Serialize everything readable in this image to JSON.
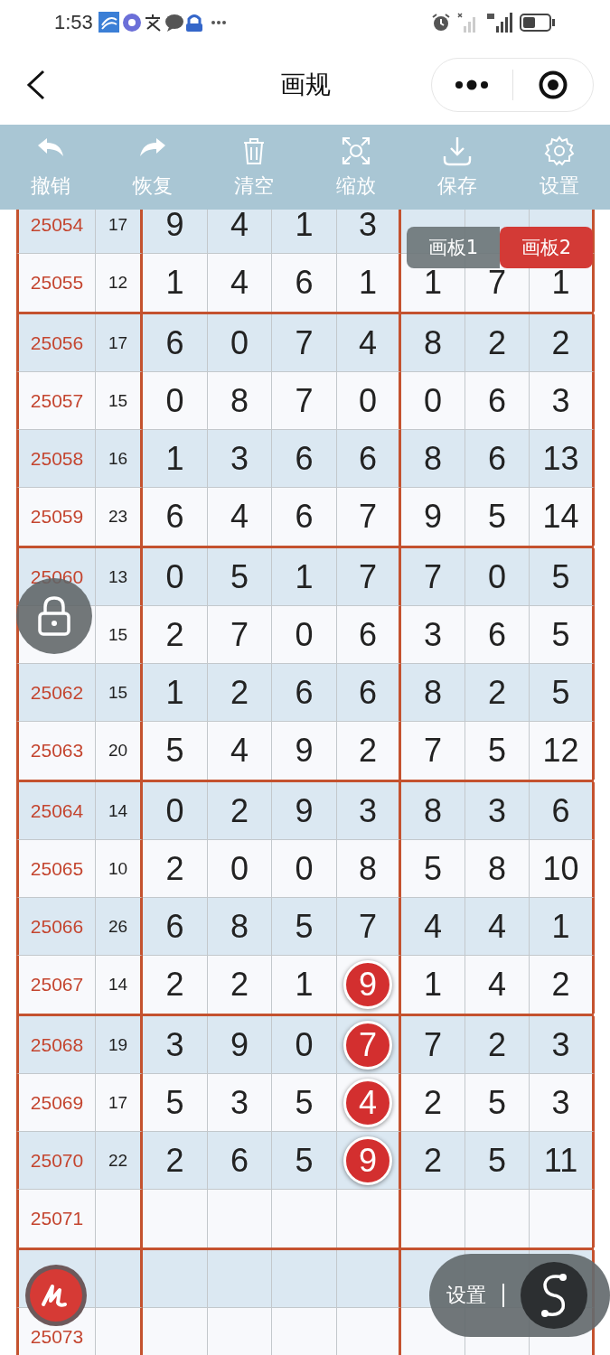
{
  "status_bar": {
    "time": "1:53"
  },
  "nav": {
    "title": "画规"
  },
  "toolbar": [
    {
      "label": "撤销"
    },
    {
      "label": "恢复"
    },
    {
      "label": "清空"
    },
    {
      "label": "缩放"
    },
    {
      "label": "保存"
    },
    {
      "label": "设置"
    }
  ],
  "board_tabs": [
    {
      "label": "画板1",
      "selected": false
    },
    {
      "label": "画板2",
      "selected": true
    }
  ],
  "groups": [
    {
      "rows": [
        {
          "issue": "25054",
          "sum": "17",
          "cells": [
            {
              "v": "9",
              "circled": false
            },
            {
              "v": "4",
              "circled": false
            },
            {
              "v": "1",
              "circled": false
            },
            {
              "v": "3",
              "circled": false
            }
          ]
        },
        {
          "issue": "25055",
          "sum": "12",
          "cells": [
            {
              "v": "1",
              "circled": false
            },
            {
              "v": "4",
              "circled": false
            },
            {
              "v": "6",
              "circled": false
            },
            {
              "v": "1",
              "circled": false
            },
            {
              "v": "1",
              "circled": false
            },
            {
              "v": "7",
              "circled": false
            },
            {
              "v": "1",
              "circled": false
            }
          ]
        }
      ]
    },
    {
      "rows": [
        {
          "issue": "25056",
          "sum": "17",
          "cells": [
            {
              "v": "6",
              "circled": false
            },
            {
              "v": "0",
              "circled": false
            },
            {
              "v": "7",
              "circled": false
            },
            {
              "v": "4",
              "circled": false
            },
            {
              "v": "8",
              "circled": false
            },
            {
              "v": "2",
              "circled": false
            },
            {
              "v": "2",
              "circled": false
            }
          ]
        },
        {
          "issue": "25057",
          "sum": "15",
          "cells": [
            {
              "v": "0",
              "circled": false
            },
            {
              "v": "8",
              "circled": false
            },
            {
              "v": "7",
              "circled": false
            },
            {
              "v": "0",
              "circled": false
            },
            {
              "v": "0",
              "circled": false
            },
            {
              "v": "6",
              "circled": false
            },
            {
              "v": "3",
              "circled": false
            }
          ]
        },
        {
          "issue": "25058",
          "sum": "16",
          "cells": [
            {
              "v": "1",
              "circled": false
            },
            {
              "v": "3",
              "circled": false
            },
            {
              "v": "6",
              "circled": false
            },
            {
              "v": "6",
              "circled": false
            },
            {
              "v": "8",
              "circled": false
            },
            {
              "v": "6",
              "circled": false
            },
            {
              "v": "13",
              "circled": false
            }
          ]
        },
        {
          "issue": "25059",
          "sum": "23",
          "cells": [
            {
              "v": "6",
              "circled": false
            },
            {
              "v": "4",
              "circled": false
            },
            {
              "v": "6",
              "circled": false
            },
            {
              "v": "7",
              "circled": false
            },
            {
              "v": "9",
              "circled": false
            },
            {
              "v": "5",
              "circled": false
            },
            {
              "v": "14",
              "circled": false
            }
          ]
        }
      ]
    },
    {
      "rows": [
        {
          "issue": "25060",
          "sum": "13",
          "cells": [
            {
              "v": "0",
              "circled": false
            },
            {
              "v": "5",
              "circled": false
            },
            {
              "v": "1",
              "circled": false
            },
            {
              "v": "7",
              "circled": false
            },
            {
              "v": "7",
              "circled": false
            },
            {
              "v": "0",
              "circled": false
            },
            {
              "v": "5",
              "circled": false
            }
          ]
        },
        {
          "sum": "15",
          "cells": [
            {
              "v": "2",
              "circled": false
            },
            {
              "v": "7",
              "circled": false
            },
            {
              "v": "0",
              "circled": false
            },
            {
              "v": "6",
              "circled": false
            },
            {
              "v": "3",
              "circled": false
            },
            {
              "v": "6",
              "circled": false
            },
            {
              "v": "5",
              "circled": false
            }
          ]
        },
        {
          "issue": "25062",
          "sum": "15",
          "cells": [
            {
              "v": "1",
              "circled": false
            },
            {
              "v": "2",
              "circled": false
            },
            {
              "v": "6",
              "circled": false
            },
            {
              "v": "6",
              "circled": false
            },
            {
              "v": "8",
              "circled": false
            },
            {
              "v": "2",
              "circled": false
            },
            {
              "v": "5",
              "circled": false
            }
          ]
        },
        {
          "issue": "25063",
          "sum": "20",
          "cells": [
            {
              "v": "5",
              "circled": false
            },
            {
              "v": "4",
              "circled": false
            },
            {
              "v": "9",
              "circled": false
            },
            {
              "v": "2",
              "circled": false
            },
            {
              "v": "7",
              "circled": false
            },
            {
              "v": "5",
              "circled": false
            },
            {
              "v": "12",
              "circled": false
            }
          ]
        }
      ]
    },
    {
      "rows": [
        {
          "issue": "25064",
          "sum": "14",
          "cells": [
            {
              "v": "0",
              "circled": false
            },
            {
              "v": "2",
              "circled": false
            },
            {
              "v": "9",
              "circled": false
            },
            {
              "v": "3",
              "circled": false
            },
            {
              "v": "8",
              "circled": false
            },
            {
              "v": "3",
              "circled": false
            },
            {
              "v": "6",
              "circled": false
            }
          ]
        },
        {
          "issue": "25065",
          "sum": "10",
          "cells": [
            {
              "v": "2",
              "circled": false
            },
            {
              "v": "0",
              "circled": false
            },
            {
              "v": "0",
              "circled": false
            },
            {
              "v": "8",
              "circled": false
            },
            {
              "v": "5",
              "circled": false
            },
            {
              "v": "8",
              "circled": false
            },
            {
              "v": "10",
              "circled": false
            }
          ]
        },
        {
          "issue": "25066",
          "sum": "26",
          "cells": [
            {
              "v": "6",
              "circled": false
            },
            {
              "v": "8",
              "circled": false
            },
            {
              "v": "5",
              "circled": false
            },
            {
              "v": "7",
              "circled": false
            },
            {
              "v": "4",
              "circled": false
            },
            {
              "v": "4",
              "circled": false
            },
            {
              "v": "1",
              "circled": false
            }
          ]
        },
        {
          "issue": "25067",
          "sum": "14",
          "cells": [
            {
              "v": "2",
              "circled": false
            },
            {
              "v": "2",
              "circled": false
            },
            {
              "v": "1",
              "circled": false
            },
            {
              "v": "9",
              "circled": true
            },
            {
              "v": "1",
              "circled": false
            },
            {
              "v": "4",
              "circled": false
            },
            {
              "v": "2",
              "circled": false
            }
          ]
        }
      ]
    },
    {
      "rows": [
        {
          "issue": "25068",
          "sum": "19",
          "cells": [
            {
              "v": "3",
              "circled": false
            },
            {
              "v": "9",
              "circled": false
            },
            {
              "v": "0",
              "circled": false
            },
            {
              "v": "7",
              "circled": true
            },
            {
              "v": "7",
              "circled": false
            },
            {
              "v": "2",
              "circled": false
            },
            {
              "v": "3",
              "circled": false
            }
          ]
        },
        {
          "issue": "25069",
          "sum": "17",
          "cells": [
            {
              "v": "5",
              "circled": false
            },
            {
              "v": "3",
              "circled": false
            },
            {
              "v": "5",
              "circled": false
            },
            {
              "v": "4",
              "circled": true
            },
            {
              "v": "2",
              "circled": false
            },
            {
              "v": "5",
              "circled": false
            },
            {
              "v": "3",
              "circled": false
            }
          ]
        },
        {
          "issue": "25070",
          "sum": "22",
          "cells": [
            {
              "v": "2",
              "circled": false
            },
            {
              "v": "6",
              "circled": false
            },
            {
              "v": "5",
              "circled": false
            },
            {
              "v": "9",
              "circled": true
            },
            {
              "v": "2",
              "circled": false
            },
            {
              "v": "5",
              "circled": false
            },
            {
              "v": "11",
              "circled": false
            }
          ]
        },
        {
          "issue": "25071"
        }
      ]
    },
    {
      "rows": [
        {},
        {
          "issue": "25073"
        }
      ]
    }
  ],
  "fab": {
    "label": "设置"
  }
}
